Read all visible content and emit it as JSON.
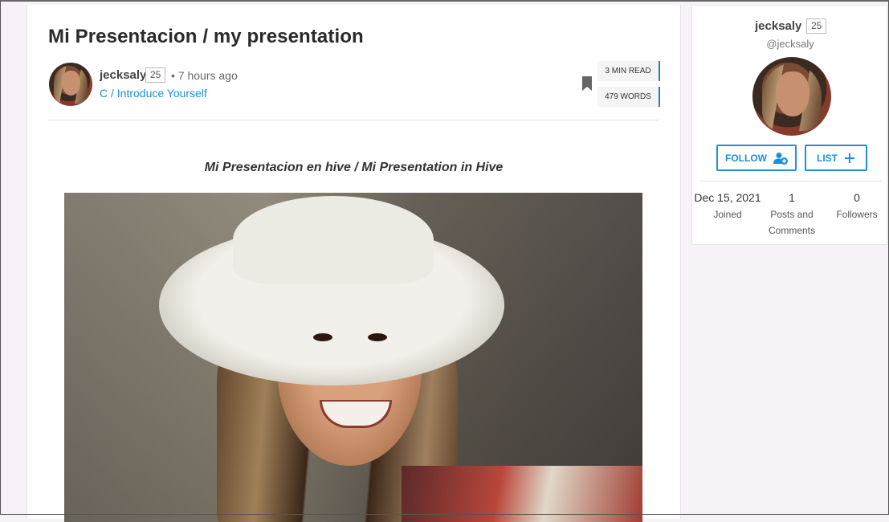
{
  "post": {
    "title": "Mi Presentacion / my presentation",
    "author": "jecksaly",
    "reputation": "25",
    "time": "• 7 hours ago",
    "community": "C / Introduce Yourself",
    "read_time": "3 MIN READ",
    "word_count": "479 WORDS",
    "subtitle": "Mi Presentacion en hive / Mi Presentation in Hive"
  },
  "profile": {
    "name": "jecksaly",
    "reputation": "25",
    "handle": "@jecksaly",
    "follow_label": "FOLLOW",
    "list_label": "LIST",
    "stats": [
      {
        "value": "Dec 15, 2021",
        "label": "Joined"
      },
      {
        "value": "1",
        "label": "Posts and Comments"
      },
      {
        "value": "0",
        "label": "Followers"
      }
    ]
  },
  "icons": {
    "bookmark": "bookmark-icon",
    "follow": "user-plus-icon",
    "list": "plus-icon"
  },
  "colors": {
    "accent": "#1e90d8",
    "chip_border": "#2a7fa8"
  }
}
